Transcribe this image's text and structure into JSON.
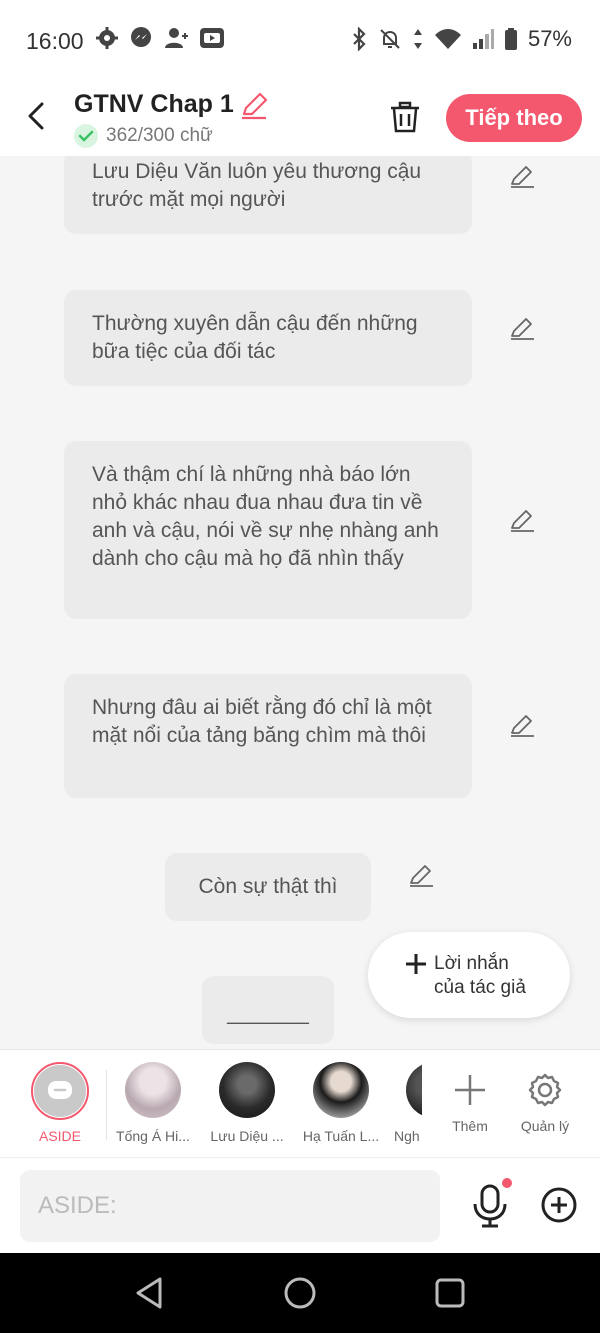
{
  "status": {
    "time": "16:00",
    "battery": "57%",
    "left_icons": [
      "settings-icon",
      "messenger-icon",
      "person-add-icon",
      "video-icon"
    ],
    "right_icons": [
      "bluetooth-icon",
      "mute-icon",
      "data-icon",
      "wifi-icon",
      "signal-icon",
      "battery-icon"
    ]
  },
  "header": {
    "title": "GTNV Chap 1",
    "word_count": "362/300 chữ",
    "next_button": "Tiếp theo"
  },
  "messages": [
    "Lưu Diệu Văn luôn yêu thương cậu trước mặt mọi người",
    "Thường xuyên dẫn cậu đến những bữa tiệc của đối tác",
    "Và thậm chí là những nhà báo lớn nhỏ khác nhau đua nhau đưa tin về anh và cậu, nói về sự nhẹ nhàng anh dành cho cậu mà họ đã nhìn thấy",
    "Nhưng đâu ai biết rằng đó chỉ là một mặt nổi của tảng băng chìm mà thôi",
    "Còn sự thật thì",
    "_______"
  ],
  "fab": {
    "line1": "Lời nhắn",
    "line2": "của tác giả"
  },
  "characters": {
    "aside_label": "ASIDE",
    "items": [
      {
        "name": "Tống Á Hi..."
      },
      {
        "name": "Lưu Diệu ..."
      },
      {
        "name": "Hạ Tuấn L..."
      },
      {
        "name": "Ngh"
      }
    ],
    "add_label": "Thêm",
    "manage_label": "Quản lý"
  },
  "input": {
    "placeholder": "ASIDE:"
  },
  "colors": {
    "accent": "#f4586e",
    "bubble": "#ebebeb"
  }
}
